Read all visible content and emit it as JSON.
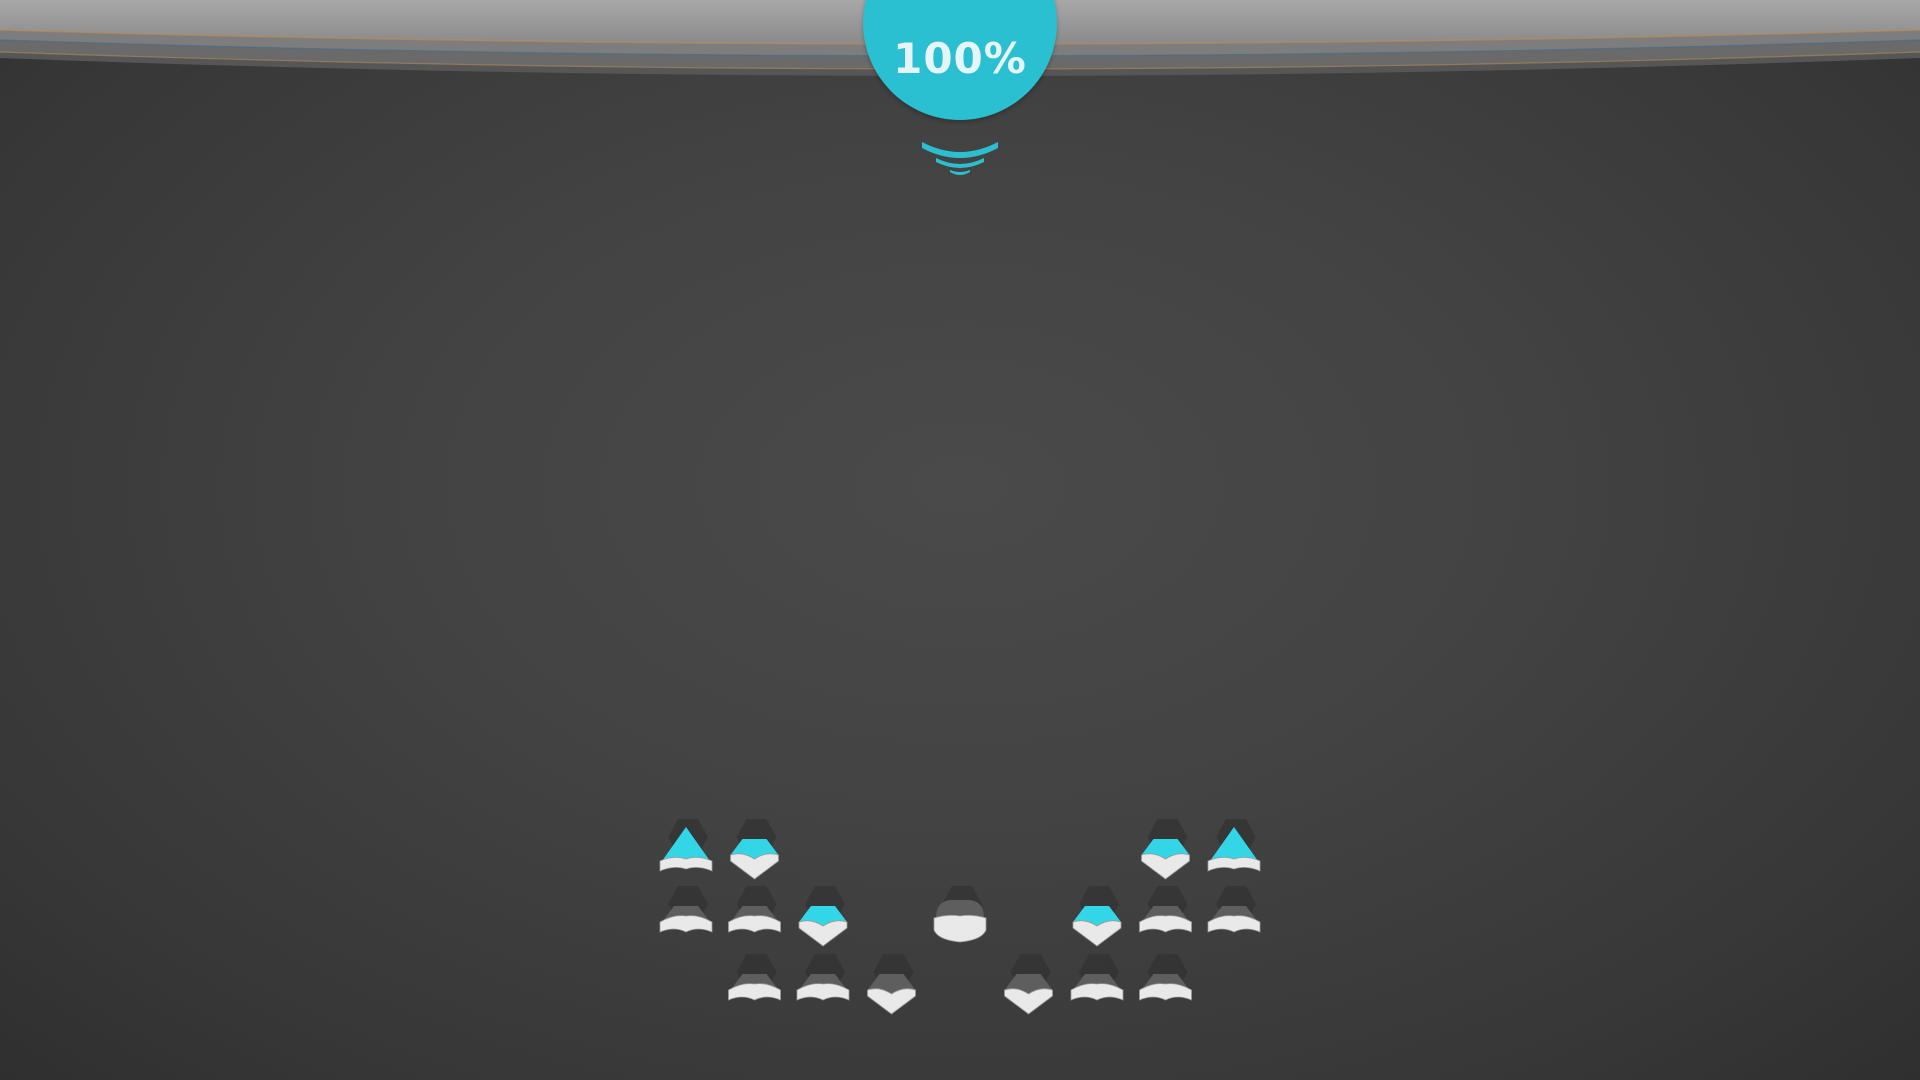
{
  "hud": {
    "progress_label": "100%",
    "progress": 1.0
  },
  "colors": {
    "accent": "#2bc0d1",
    "accent_light": "#33d6e6",
    "piece_dark": "#5e5e5e",
    "piece_light": "#e9e9e9",
    "background": "#434343",
    "band": "#9a9a9a"
  },
  "icons": {
    "signal": "signal-arcs-icon",
    "piece": "gem-piece-icon"
  },
  "pieces": [
    {
      "row": 0,
      "col": 0,
      "state": "lit",
      "shape": "arrow"
    },
    {
      "row": 0,
      "col": 1,
      "state": "lit",
      "shape": "gem"
    },
    {
      "row": 0,
      "col": 7,
      "state": "lit",
      "shape": "gem"
    },
    {
      "row": 0,
      "col": 8,
      "state": "lit",
      "shape": "arrow"
    },
    {
      "row": 1,
      "col": 0,
      "state": "dark",
      "shape": "flat"
    },
    {
      "row": 1,
      "col": 1,
      "state": "dark",
      "shape": "flat"
    },
    {
      "row": 1,
      "col": 2,
      "state": "lit",
      "shape": "gem"
    },
    {
      "row": 1,
      "col": 4,
      "state": "dark",
      "shape": "round"
    },
    {
      "row": 1,
      "col": 6,
      "state": "lit",
      "shape": "gem"
    },
    {
      "row": 1,
      "col": 7,
      "state": "dark",
      "shape": "flat"
    },
    {
      "row": 1,
      "col": 8,
      "state": "dark",
      "shape": "flat"
    },
    {
      "row": 2,
      "col": 1,
      "state": "dark",
      "shape": "flat"
    },
    {
      "row": 2,
      "col": 2,
      "state": "dark",
      "shape": "flat"
    },
    {
      "row": 2,
      "col": 3,
      "state": "dark",
      "shape": "gem"
    },
    {
      "row": 2,
      "col": 5,
      "state": "dark",
      "shape": "gem"
    },
    {
      "row": 2,
      "col": 6,
      "state": "dark",
      "shape": "flat"
    },
    {
      "row": 2,
      "col": 7,
      "state": "dark",
      "shape": "flat"
    }
  ]
}
